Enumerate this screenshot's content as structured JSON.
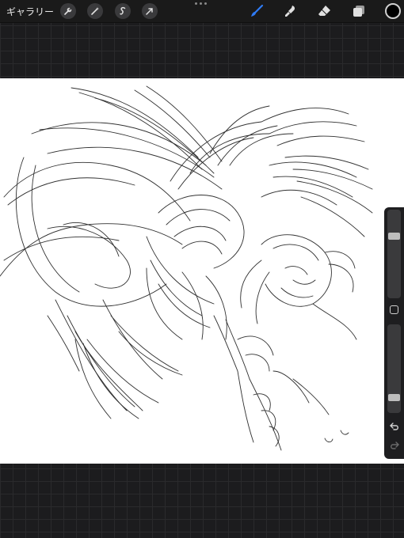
{
  "toolbar": {
    "gallery_label": "ギャラリー",
    "left_tools": [
      "wrench-icon",
      "magic-wand-icon",
      "selection-icon",
      "transform-arrow-icon"
    ],
    "right_tools": [
      "brush-icon",
      "smudge-icon",
      "eraser-icon",
      "layers-icon"
    ],
    "active_tool": "brush",
    "accent_color": "#2f7bf5",
    "current_color": "#000000"
  },
  "sidebar": {
    "brush_size_level": 0.72,
    "opacity_level": 0.15
  }
}
